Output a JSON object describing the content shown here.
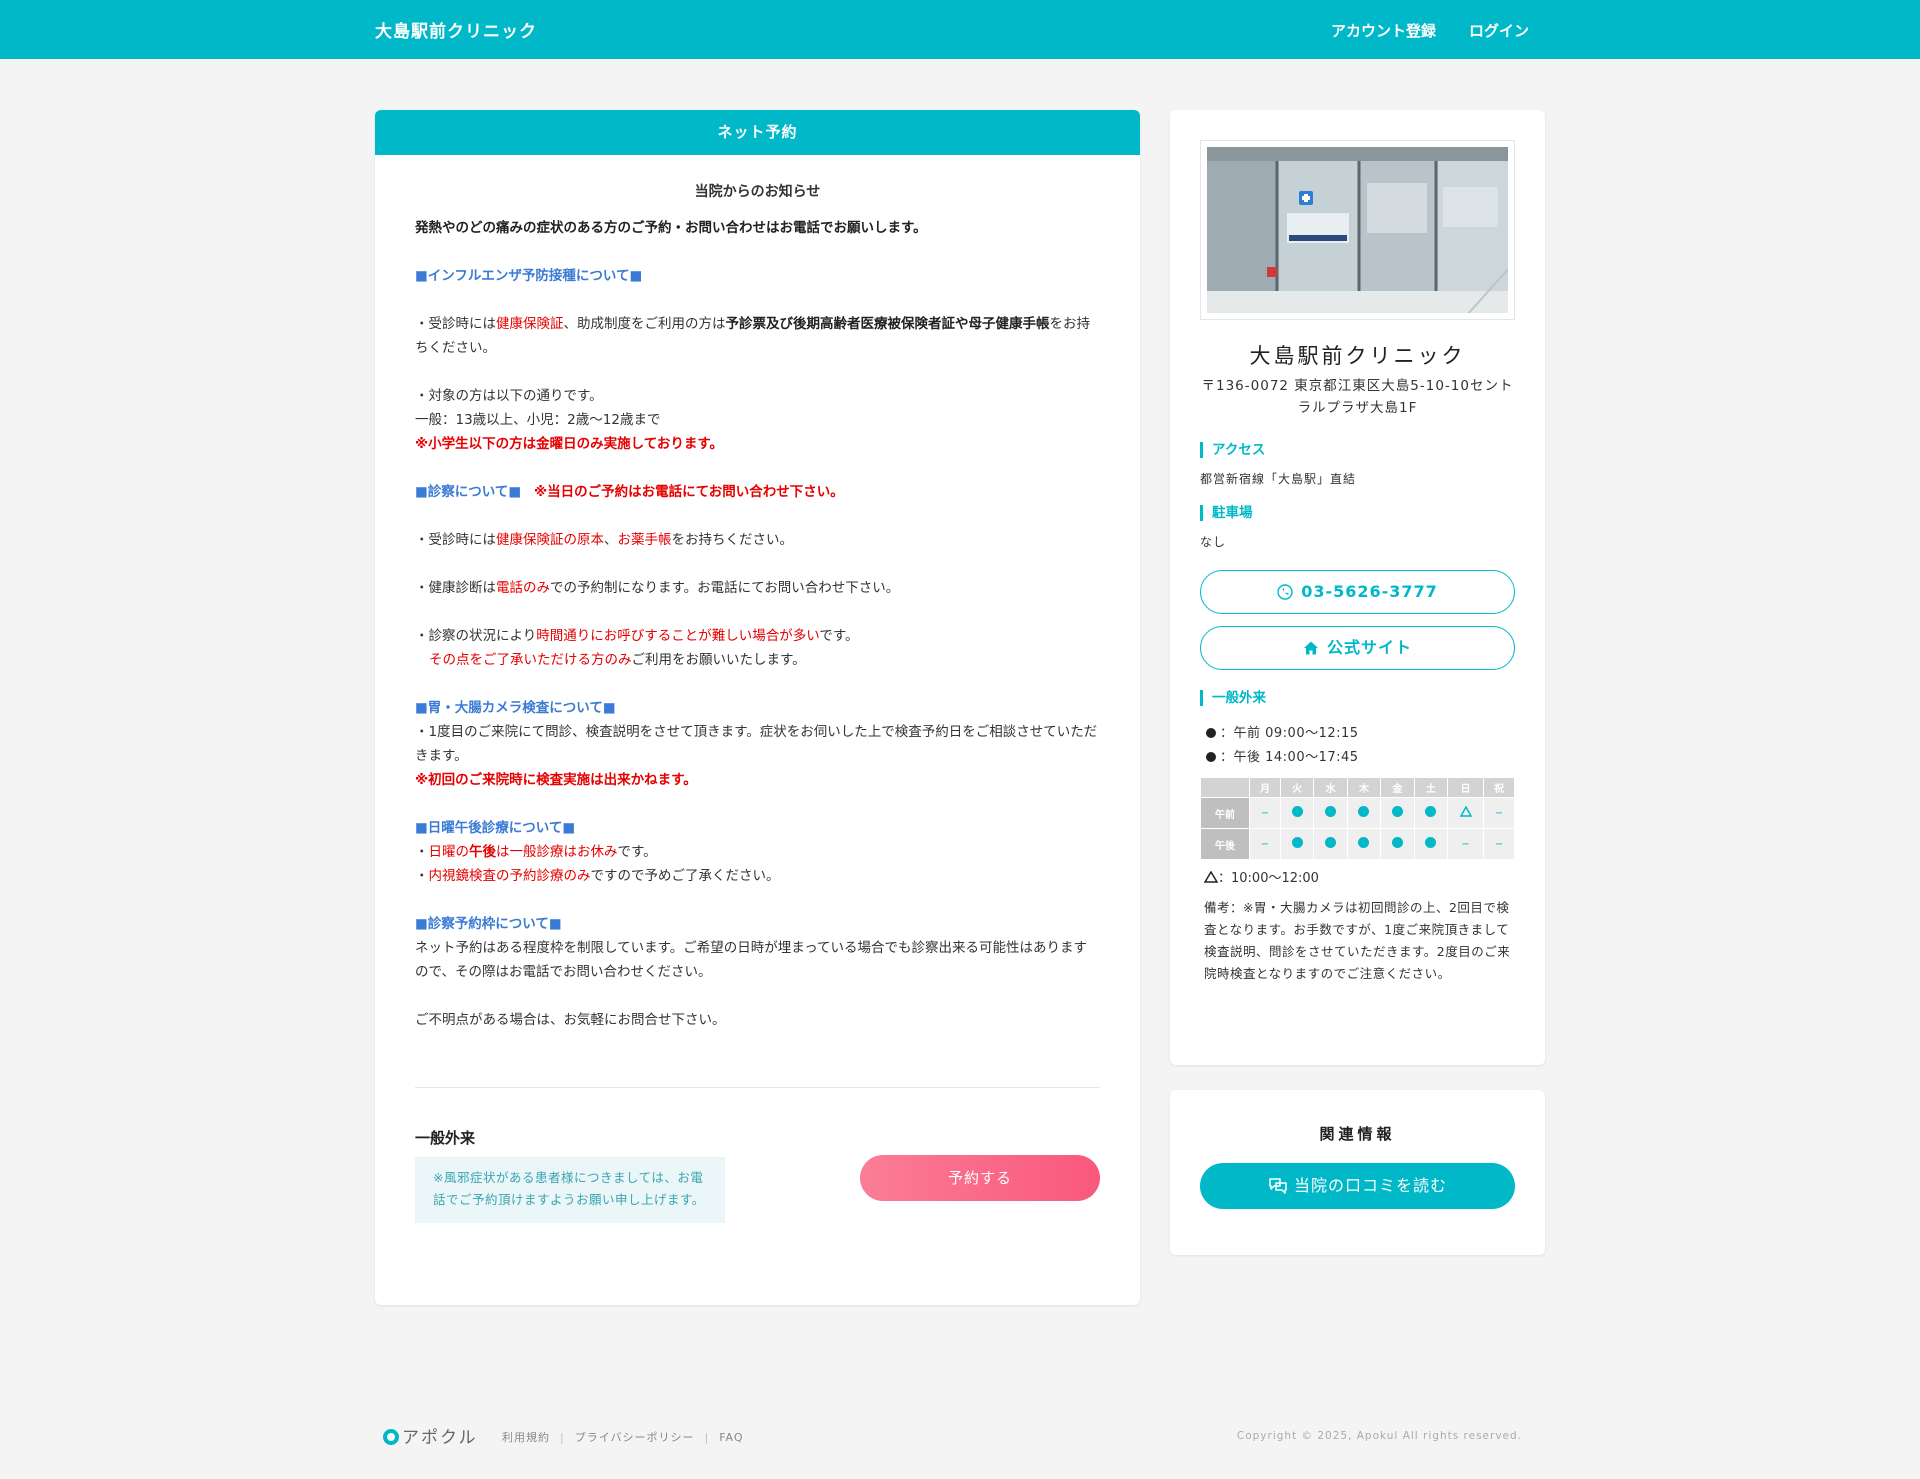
{
  "header": {
    "brand": "大島駅前クリニック",
    "register": "アカウント登録",
    "login": "ログイン"
  },
  "main": {
    "title": "ネット予約",
    "notice_title": "当院からのお知らせ",
    "lead": "発熱やのどの痛みの症状のある方のご予約・お問い合わせはお電話でお願いします。",
    "influenza_heading": "■インフルエンザ予防接種について■",
    "inf_line1_a": "・受診時には",
    "inf_line1_b": "健康保険証",
    "inf_line1_c": "、助成制度をご利用の方は",
    "inf_line1_d": "予診票及び後期高齢者医療被保険者証や母子健康手帳",
    "inf_line1_e": "をお持ちください。",
    "inf_target": "・対象の方は以下の通りです。",
    "inf_ages": "一般：13歳以上、小児：2歳〜12歳まで",
    "inf_friday": "※小学生以下の方は金曜日のみ実施しております。",
    "exam_heading": "■診察について■",
    "exam_sameday": "※当日のご予約はお電話にてお問い合わせ下さい。",
    "exam_l1_a": "・受診時には",
    "exam_l1_b": "健康保険証の原本",
    "exam_l1_c": "、",
    "exam_l1_d": "お薬手帳",
    "exam_l1_e": "をお持ちください。",
    "exam_l2_a": "・健康診断は",
    "exam_l2_b": "電話のみ",
    "exam_l2_c": "での予約制になります。お電話にてお問い合わせ下さい。",
    "exam_l3_a": "・診察の状況により",
    "exam_l3_b": "時間通りにお呼びすることが難しい場合が多い",
    "exam_l3_c": "です。",
    "exam_l4_a": "その点をご了承いただける方のみ",
    "exam_l4_b": "ご利用をお願いいたします。",
    "camera_heading": "■胃・大腸カメラ検査について■",
    "camera_l1": "・1度目のご来院にて問診、検査説明をさせて頂きます。症状をお伺いした上で検査予約日をご相談させていただきます。",
    "camera_l2": "※初回のご来院時に検査実施は出来かねます。",
    "sunday_heading": "■日曜午後診療について■",
    "sun_l1_a": "・",
    "sun_l1_b": "日曜の",
    "sun_l1_c": "午後",
    "sun_l1_d": "は一般診療は",
    "sun_l1_e": "お休み",
    "sun_l1_f": "です。",
    "sun_l2_a": "・",
    "sun_l2_b": "内視鏡検査の予約診療のみ",
    "sun_l2_c": "ですので予めご了承ください。",
    "slot_heading": "■診察予約枠について■",
    "slot_text": "ネット予約はある程度枠を制限しています。ご希望の日時が埋まっている場合でも診察出来る可能性はありますので、その際はお電話でお問い合わせください。",
    "closing": "ご不明点がある場合は、お気軽にお問合せ下さい。",
    "outpatient_title": "一般外来",
    "outpatient_warning": "※風邪症状がある患者様につきましては、お電話でご予約頂けますようお願い申し上げます。",
    "reserve_button": "予約する"
  },
  "side": {
    "clinic_name": "大島駅前クリニック",
    "address": "〒136-0072 東京都江東区大島5-10-10セントラルプラザ大島1F",
    "access_title": "アクセス",
    "access_text": "都営新宿線「大島駅」直結",
    "parking_title": "駐車場",
    "parking_text": "なし",
    "phone": "03-5626-3777",
    "website": "公式サイト",
    "outpatient_title": "一般外来",
    "am_hours": "：午前 09:00〜12:15",
    "pm_hours": "：午後 14:00〜17:45",
    "schedule": {
      "days": [
        "月",
        "火",
        "水",
        "木",
        "金",
        "土",
        "日",
        "祝"
      ],
      "rows": [
        {
          "label": "午前",
          "cells": [
            "−",
            "●",
            "●",
            "●",
            "●",
            "●",
            "△",
            "−"
          ]
        },
        {
          "label": "午後",
          "cells": [
            "−",
            "●",
            "●",
            "●",
            "●",
            "●",
            "−",
            "−"
          ]
        }
      ]
    },
    "triangle_note": "：10:00〜12:00",
    "remark": "備考：※胃・大腸カメラは初回問診の上、2回目で検査となります。お手数ですが、1度ご来院頂きまして検査説明、問診をさせていただきます。2度目のご来院時検査となりますのでご注意ください。"
  },
  "related": {
    "title": "関連情報",
    "review_button": "当院の口コミを読む"
  },
  "footer": {
    "logo": "アポクル",
    "links": [
      "利用規約",
      "プライバシーポリシー",
      "FAQ"
    ],
    "copyright": "Copyright © 2025, Apokul All rights reserved."
  },
  "colors": {
    "accent": "#00b8c8",
    "reserve_button": "#f9587c",
    "alert_red": "#e60000",
    "heading_blue": "#3a7bd5"
  }
}
